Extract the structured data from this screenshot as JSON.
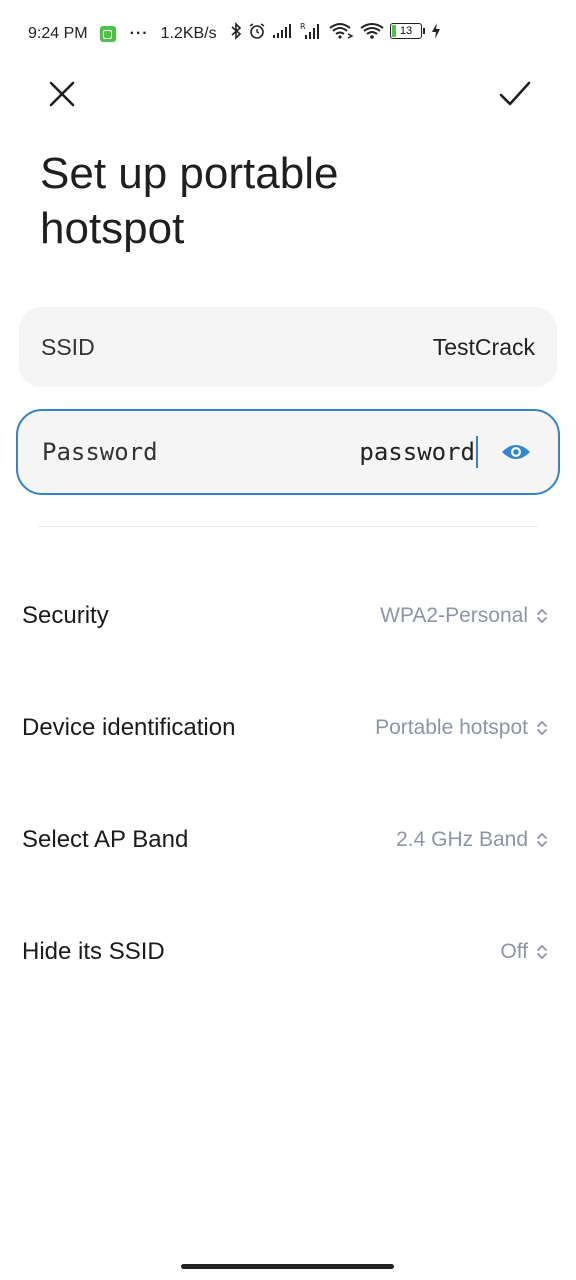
{
  "status_bar": {
    "time": "9:24 PM",
    "dots": "···",
    "net_speed": "1.2KB/s",
    "battery_level": "13",
    "icons": [
      "app-notification-icon",
      "bluetooth-icon",
      "alarm-icon",
      "signal-icon",
      "signal-roaming-icon",
      "wifi-hotspot-icon",
      "wifi-icon",
      "battery-icon",
      "charging-icon"
    ]
  },
  "header": {
    "close_icon": "close-icon",
    "confirm_icon": "check-icon",
    "title": "Set up portable hotspot"
  },
  "ssid": {
    "label": "SSID",
    "value": "TestCrack"
  },
  "password": {
    "label": "Password",
    "value": "password",
    "toggle_icon": "eye-icon"
  },
  "settings": [
    {
      "label": "Security",
      "value": "WPA2-Personal"
    },
    {
      "label": "Device identification",
      "value": "Portable hotspot"
    },
    {
      "label": "Select AP Band",
      "value": "2.4 GHz Band"
    },
    {
      "label": "Hide its SSID",
      "value": "Off"
    }
  ],
  "colors": {
    "accent": "#3582c9",
    "value_gray": "#8d95a6",
    "field_bg": "#f5f5f5"
  }
}
